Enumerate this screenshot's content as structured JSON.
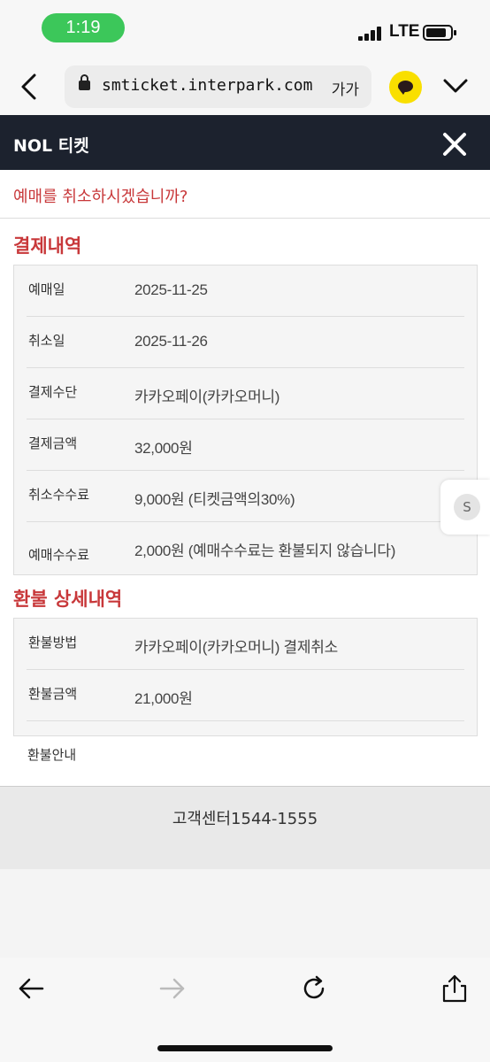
{
  "status_bar": {
    "time": "1:19",
    "network": "LTE"
  },
  "browser": {
    "url": "smticket.interpark.com",
    "text_size_label": "가가"
  },
  "app": {
    "title": "NOL 티켓"
  },
  "cancel_question": "예매를 취소하시겠습니까?",
  "payment": {
    "title": "결제내역",
    "rows": [
      {
        "label": "예매일",
        "value": "2025-11-25"
      },
      {
        "label": "취소일",
        "value": "2025-11-26"
      },
      {
        "label": "결제수단",
        "value": "카카오페이(카카오머니)"
      },
      {
        "label": "결제금액",
        "value": "32,000원"
      },
      {
        "label": "취소수수료",
        "value": "9,000원 (티켓금액의30%)"
      },
      {
        "label": "예매수수료",
        "value": "2,000원 (예매수수료는 환불되지 않습니다)"
      }
    ]
  },
  "refund": {
    "title": "환불 상세내역",
    "rows": [
      {
        "label": "환불방법",
        "value": "카카오페이(카카오머니) 결제취소"
      },
      {
        "label": "환불금액",
        "value": "21,000원"
      }
    ],
    "notice_label": "환불안내"
  },
  "floating_badge": "S",
  "footer": {
    "customer_center": "고객센터1544-1555"
  },
  "colors": {
    "accent": "#c8383a",
    "header_bg": "#1c222e",
    "status_pill": "#3cc75a",
    "kakao": "#f9df00"
  },
  "icons": [
    "back-icon",
    "lock-icon",
    "kakaotalk-icon",
    "chevron-down-icon",
    "close-icon",
    "share-icon",
    "reload-icon",
    "forward-icon"
  ]
}
